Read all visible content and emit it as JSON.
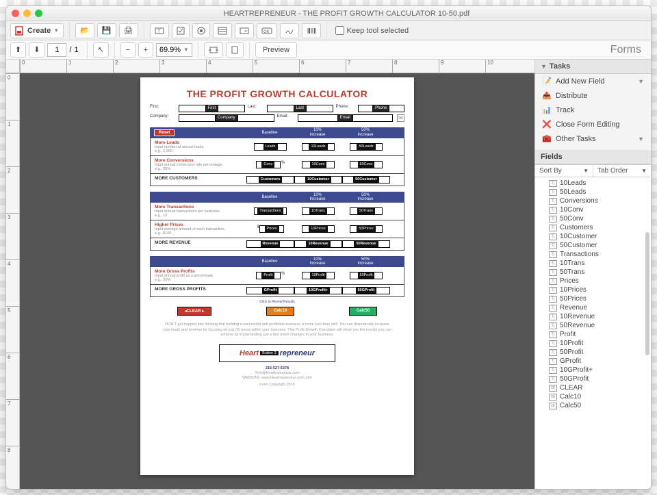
{
  "window": {
    "title": "HEARTREPRENEUR - THE PROFIT GROWTH CALCULATOR 10-50.pdf"
  },
  "toolbar1": {
    "create": "Create",
    "keep_tool": "Keep tool selected"
  },
  "toolbar2": {
    "page_current": "1",
    "page_sep": "/",
    "page_total": "1",
    "zoom": "69.9%",
    "preview": "Preview",
    "forms": "Forms"
  },
  "doc": {
    "title": "THE PROFIT GROWTH CALCULATOR",
    "labels": {
      "first": "First:",
      "last": "Last:",
      "phone": "Phone:",
      "company": "Company:",
      "email": "Email:"
    },
    "fields": {
      "first": "First",
      "last": "Last",
      "phone": "Phone",
      "company": "Company",
      "email": "Email"
    },
    "reset": "Reset",
    "cols": {
      "baseline": "Baseline",
      "c10": "10%\nIncrease",
      "c50": "50%\nIncrease"
    },
    "rows": {
      "leads": {
        "title": "More Leads",
        "hint": "Input number of annual leads,\ne.g., 1,000",
        "f": [
          "Leads",
          "10Leads",
          "50Leads"
        ]
      },
      "conv": {
        "title": "More Conversions",
        "hint": "Input annual conversion rate percentage,\ne.g., 25%",
        "f": [
          "Conv",
          "10Conv",
          "50Conv"
        ],
        "pct": "%"
      },
      "cust_sum": "MORE CUSTOMERS",
      "cust": {
        "f": [
          "Customers",
          "10Customer",
          "50Customer"
        ]
      },
      "trans": {
        "title": "More Transactions",
        "hint": "Input annual transactions per customer,\ne.g., 10",
        "f": [
          "Transactions",
          "10Trans",
          "50Trans"
        ]
      },
      "price": {
        "title": "Higher Prices",
        "hint": "Input average amount of each transaction,\ne.g., $100",
        "f": [
          "Prices",
          "10Prices",
          "50Prices"
        ],
        "dollar": "$"
      },
      "rev_sum": "MORE REVENUE",
      "rev": {
        "f": [
          "Revenue",
          "10Revenue",
          "50Revenue"
        ]
      },
      "profit": {
        "title": "More Gross Profits",
        "hint": "Input annual profit as a percentage,\ne.g., 25%",
        "f": [
          "Profit",
          "10Profit",
          "50Profit"
        ],
        "pct": "%"
      },
      "gp_sum": "MORE GROSS PROFITS",
      "gp": {
        "f": [
          "GProfit",
          "10GProfit+",
          "50GProfit"
        ]
      }
    },
    "click_reveal": "Click to Reveal Results",
    "actions": {
      "clear": "◂CLEAR ▸",
      "c10": "Calc10",
      "c50": "Calc50"
    },
    "blurb": "DON'T get trapped into thinking that building a successful and profitable business is more luck than skill. You can dramatically increase your leads and revenue by focusing on just (5) areas within your business. This Profit Growth Calculator will show you the results you can achieve by implementing just a few minor changes in your business.",
    "logo": {
      "heart": "Heart",
      "btn": "Button 3",
      "rest": "repreneur"
    },
    "contact": {
      "phone": "215-527-6378",
      "email": "Terri@Heartrepreneur.com",
      "site": "WEBSITE: www.Heartrepreneur.com.com",
      "copy": "Form Copyright 2016"
    }
  },
  "tasks": {
    "heading": "Tasks",
    "items": [
      "Add New Field",
      "Distribute",
      "Track",
      "Close Form Editing",
      "Other Tasks"
    ]
  },
  "fieldspanel": {
    "heading": "Fields",
    "sortby": "Sort By",
    "taborder": "Tab Order",
    "list": [
      {
        "t": "T",
        "n": "10Leads"
      },
      {
        "t": "T",
        "n": "50Leads"
      },
      {
        "t": "T",
        "n": "Conversions"
      },
      {
        "t": "T",
        "n": "10Conv"
      },
      {
        "t": "T",
        "n": "50Conv"
      },
      {
        "t": "T",
        "n": "Customers"
      },
      {
        "t": "T",
        "n": "10Customer"
      },
      {
        "t": "T",
        "n": "50Customer"
      },
      {
        "t": "T",
        "n": "Transactions"
      },
      {
        "t": "T",
        "n": "10Trans"
      },
      {
        "t": "T",
        "n": "50Trans"
      },
      {
        "t": "T",
        "n": "Prices"
      },
      {
        "t": "T",
        "n": "10Prices"
      },
      {
        "t": "T",
        "n": "50Prices"
      },
      {
        "t": "T",
        "n": "Revenue"
      },
      {
        "t": "T",
        "n": "10Revenue"
      },
      {
        "t": "T",
        "n": "50Revenue"
      },
      {
        "t": "T",
        "n": "Profit"
      },
      {
        "t": "T",
        "n": "10Profit"
      },
      {
        "t": "T",
        "n": "50Profit"
      },
      {
        "t": "T",
        "n": "GProfit"
      },
      {
        "t": "T",
        "n": "10GProfit+"
      },
      {
        "t": "T",
        "n": "50GProfit"
      },
      {
        "t": "OK",
        "n": "CLEAR"
      },
      {
        "t": "OK",
        "n": "Calc10"
      },
      {
        "t": "OK",
        "n": "Calc50"
      }
    ]
  },
  "ruler": {
    "h": [
      "0",
      "1",
      "2",
      "3",
      "4",
      "5",
      "6",
      "7",
      "8",
      "9",
      "10"
    ],
    "v": [
      "0",
      "1",
      "2",
      "3",
      "4",
      "5",
      "6",
      "7",
      "8"
    ]
  }
}
